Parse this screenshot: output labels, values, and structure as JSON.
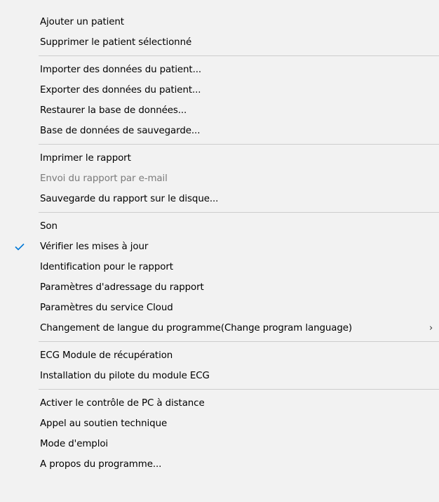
{
  "menu": {
    "groups": [
      {
        "items": [
          {
            "label": "Ajouter un patient"
          },
          {
            "label": "Supprimer le patient sélectionné"
          }
        ]
      },
      {
        "items": [
          {
            "label": "Importer des données du patient..."
          },
          {
            "label": "Exporter des données du patient..."
          },
          {
            "label": "Restaurer la base de données..."
          },
          {
            "label": "Base de données de sauvegarde..."
          }
        ]
      },
      {
        "items": [
          {
            "label": "Imprimer le rapport"
          },
          {
            "label": "Envoi du rapport par e-mail",
            "disabled": true
          },
          {
            "label": "Sauvegarde du rapport sur le disque..."
          }
        ]
      },
      {
        "items": [
          {
            "label": "Son"
          },
          {
            "label": "Vérifier les mises à jour",
            "checked": true
          },
          {
            "label": "Identification pour le rapport"
          },
          {
            "label": "Paramètres d'adressage du rapport"
          },
          {
            "label": "Paramètres du service Cloud"
          },
          {
            "label": "Changement de langue du programme(Change program language)",
            "submenu": true,
            "submenu_glyph": "›"
          }
        ]
      },
      {
        "items": [
          {
            "label": "ECG Module de récupération"
          },
          {
            "label": "Installation du pilote du module ECG"
          }
        ]
      },
      {
        "items": [
          {
            "label": "Activer le contrôle de PC à distance"
          },
          {
            "label": "Appel au soutien technique"
          },
          {
            "label": "Mode d'emploi"
          },
          {
            "label": "A propos du programme..."
          }
        ]
      }
    ],
    "colors": {
      "background": "#f2f2f2",
      "text": "#000000",
      "disabled_text": "#7a7a7a",
      "separator": "#cdcdcd",
      "checkmark": "#0078d7"
    },
    "icons": {
      "checkmark": "checkmark-icon",
      "submenu": "chevron-right-icon"
    }
  }
}
